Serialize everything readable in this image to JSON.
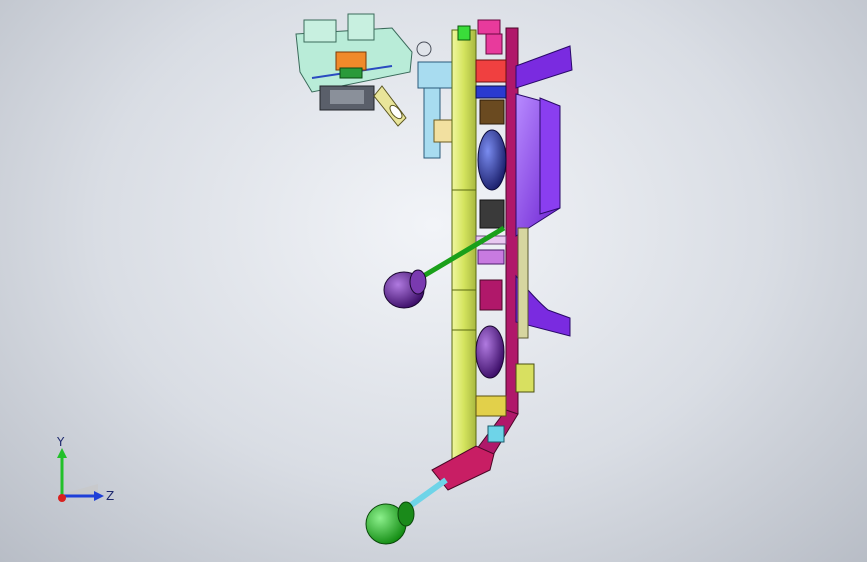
{
  "viewport": {
    "background_colors": [
      "#f2f4f8",
      "#b8bdc6"
    ]
  },
  "triad": {
    "y_label": "Y",
    "z_label": "Z",
    "colors": {
      "y": "#22c02a",
      "z": "#1e3fd8",
      "x": "#d8201e"
    }
  },
  "model": {
    "part_colors": {
      "plate": "#d9e86a",
      "frame": "#b0186a",
      "bracket": "#7a2be0",
      "fixture": "#9fe0c8",
      "knob_purple": "#5a1c8c",
      "knob_green": "#2ec82e",
      "arm_cyan": "#6ed4e8",
      "elbow": "#c81e64",
      "ring": "#c9b24a"
    }
  }
}
